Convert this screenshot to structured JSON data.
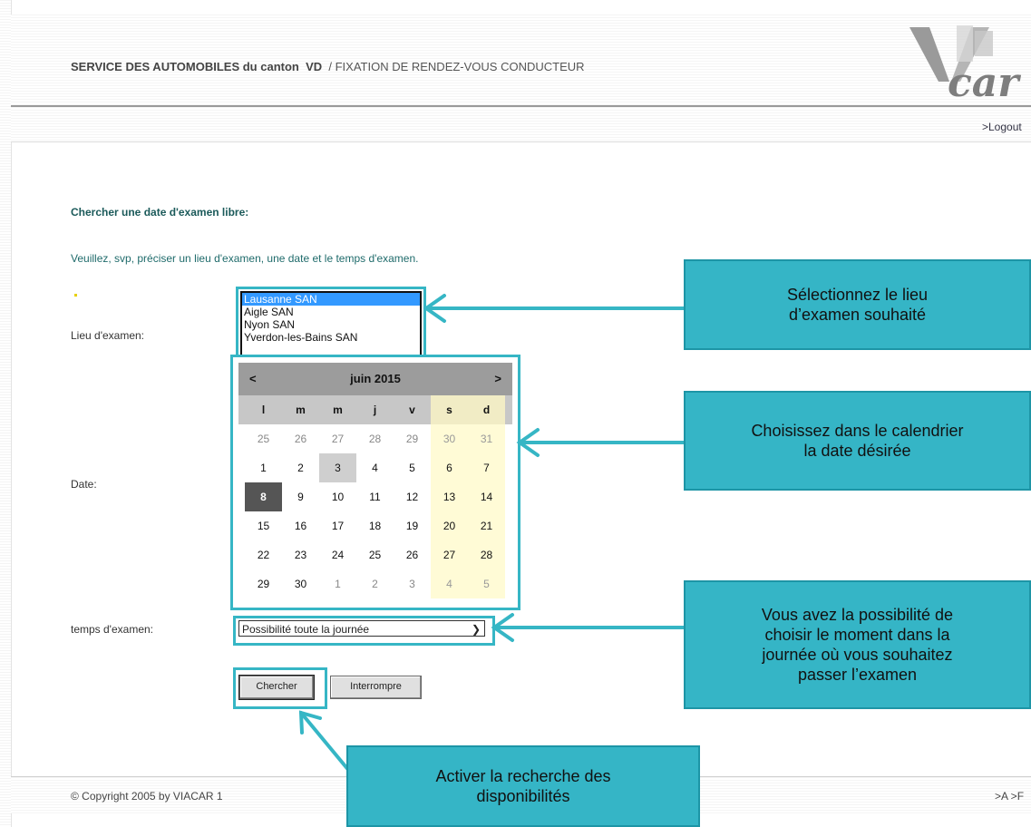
{
  "header": {
    "service_bold": "SERVICE DES AUTOMOBILES du canton",
    "canton_code": "VD",
    "subtitle": "/ FIXATION DE RENDEZ-VOUS CONDUCTEUR",
    "logo_text": "VIACAR",
    "logout": ">Logout"
  },
  "form": {
    "heading": "Chercher une date d'examen libre:",
    "instructions": "Veuillez, svp, préciser un lieu d'examen, une date et le temps d'examen.",
    "lieu_label": "Lieu d'examen:",
    "date_label": "Date:",
    "time_label": "temps d'examen:",
    "locations": [
      "Lausanne SAN",
      "Aigle SAN",
      "Nyon SAN",
      "Yverdon-les-Bains SAN"
    ],
    "selected_location": "Lausanne SAN",
    "time_value": "Possibilité toute la journée",
    "search_button": "Chercher",
    "cancel_button": "Interrompre"
  },
  "calendar": {
    "prev": "<",
    "next": ">",
    "month_title": "juin 2015",
    "weekdays": [
      "l",
      "m",
      "m",
      "j",
      "v",
      "s",
      "d"
    ],
    "weeks": [
      [
        "25",
        "26",
        "27",
        "28",
        "29",
        "30",
        "31"
      ],
      [
        "1",
        "2",
        "3",
        "4",
        "5",
        "6",
        "7"
      ],
      [
        "8",
        "9",
        "10",
        "11",
        "12",
        "13",
        "14"
      ],
      [
        "15",
        "16",
        "17",
        "18",
        "19",
        "20",
        "21"
      ],
      [
        "22",
        "23",
        "24",
        "25",
        "26",
        "27",
        "28"
      ],
      [
        "29",
        "30",
        "1",
        "2",
        "3",
        "4",
        "5"
      ]
    ],
    "today": "3",
    "selected": "8"
  },
  "footer": {
    "copyright": "© Copyright 2005 by VIACAR   1",
    "right_links": ">A >F"
  },
  "callouts": {
    "lieu": "Sélectionnez le lieu\nd’examen souhaité",
    "calendar": "Choisissez dans le calendrier\nla date désirée",
    "time": "Vous avez la possibilité de\nchoisir le moment dans la\njournée où vous souhaitez\npasser l’examen",
    "search": "Activer la recherche des\ndisponibilités"
  },
  "colors": {
    "callout_fill": "#35b5c6",
    "highlight_border": "#36b6c5",
    "heading_teal": "#1b5a5a",
    "selected_option": "#3399ff",
    "weekend_bg": "#fffbd6"
  }
}
